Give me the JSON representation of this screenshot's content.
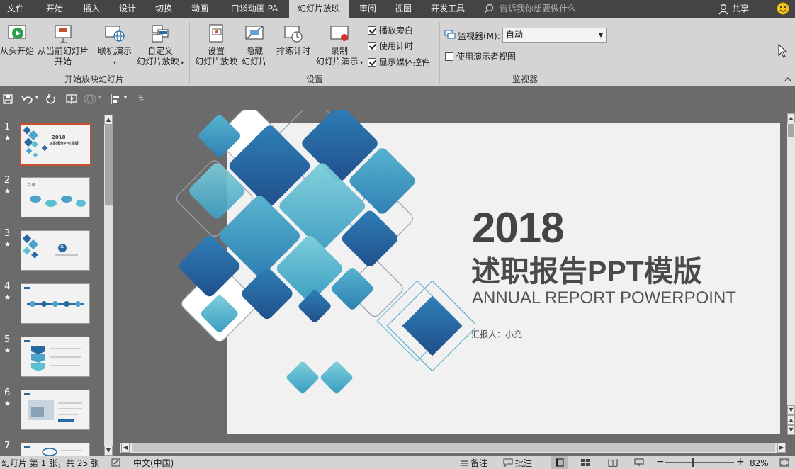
{
  "menu": {
    "tabs": [
      {
        "label": "文件"
      },
      {
        "label": "开始"
      },
      {
        "label": "插入"
      },
      {
        "label": "设计"
      },
      {
        "label": "切换"
      },
      {
        "label": "动画"
      },
      {
        "label": "口袋动画 PA"
      },
      {
        "label": "幻灯片放映"
      },
      {
        "label": "审阅"
      },
      {
        "label": "视图"
      },
      {
        "label": "开发工具"
      }
    ],
    "active_tab": "幻灯片放映",
    "tell_me_placeholder": "告诉我你想要做什么",
    "share_label": "共享"
  },
  "ribbon": {
    "group_start": {
      "label": "开始放映幻灯片",
      "from_beginning": "从头开始",
      "from_current_line1": "从当前幻灯片",
      "from_current_line2": "开始",
      "online_present": "联机演示",
      "custom_line1": "自定义",
      "custom_line2": "幻灯片放映"
    },
    "group_setup": {
      "label": "设置",
      "setup_line1": "设置",
      "setup_line2": "幻灯片放映",
      "hide_line1": "隐藏",
      "hide_line2": "幻灯片",
      "rehearse": "排练计时",
      "record_line1": "录制",
      "record_line2": "幻灯片演示",
      "play_narrations": "播放旁白",
      "use_timings": "使用计时",
      "show_media_controls": "显示媒体控件"
    },
    "group_monitors": {
      "label": "监视器",
      "monitor_label": "监视器(M):",
      "monitor_value": "自动",
      "presenter_view": "使用演示者视图"
    }
  },
  "thumbnails": [
    {
      "number": "1",
      "star": "★"
    },
    {
      "number": "2",
      "star": "★"
    },
    {
      "number": "3",
      "star": "★"
    },
    {
      "number": "4",
      "star": "★"
    },
    {
      "number": "5",
      "star": "★"
    },
    {
      "number": "6",
      "star": "★"
    },
    {
      "number": "7",
      "star": ""
    }
  ],
  "thumb_text": {
    "t1_year": "2018",
    "t1_title": "述职报告PPT模版",
    "t2_title": "目录",
    "t3_num": "01"
  },
  "slide": {
    "year": "2018",
    "title": "述职报告PPT模版",
    "subtitle": "ANNUAL REPORT POWERPOINT",
    "reporter": "汇报人：小充"
  },
  "status": {
    "slide_info": "幻灯片 第 1 张，共 25 张",
    "language": "中文(中国)",
    "notes": "备注",
    "comments": "批注",
    "zoom": "82%"
  },
  "colors": {
    "accent_tab": "#d4d4d4",
    "menubar_bg": "#444444",
    "workspace_bg": "#6b6b6b",
    "active_thumb_border": "#c8502c",
    "tile_dark": "#2a6aa3",
    "tile_light": "#5ac0d0"
  }
}
